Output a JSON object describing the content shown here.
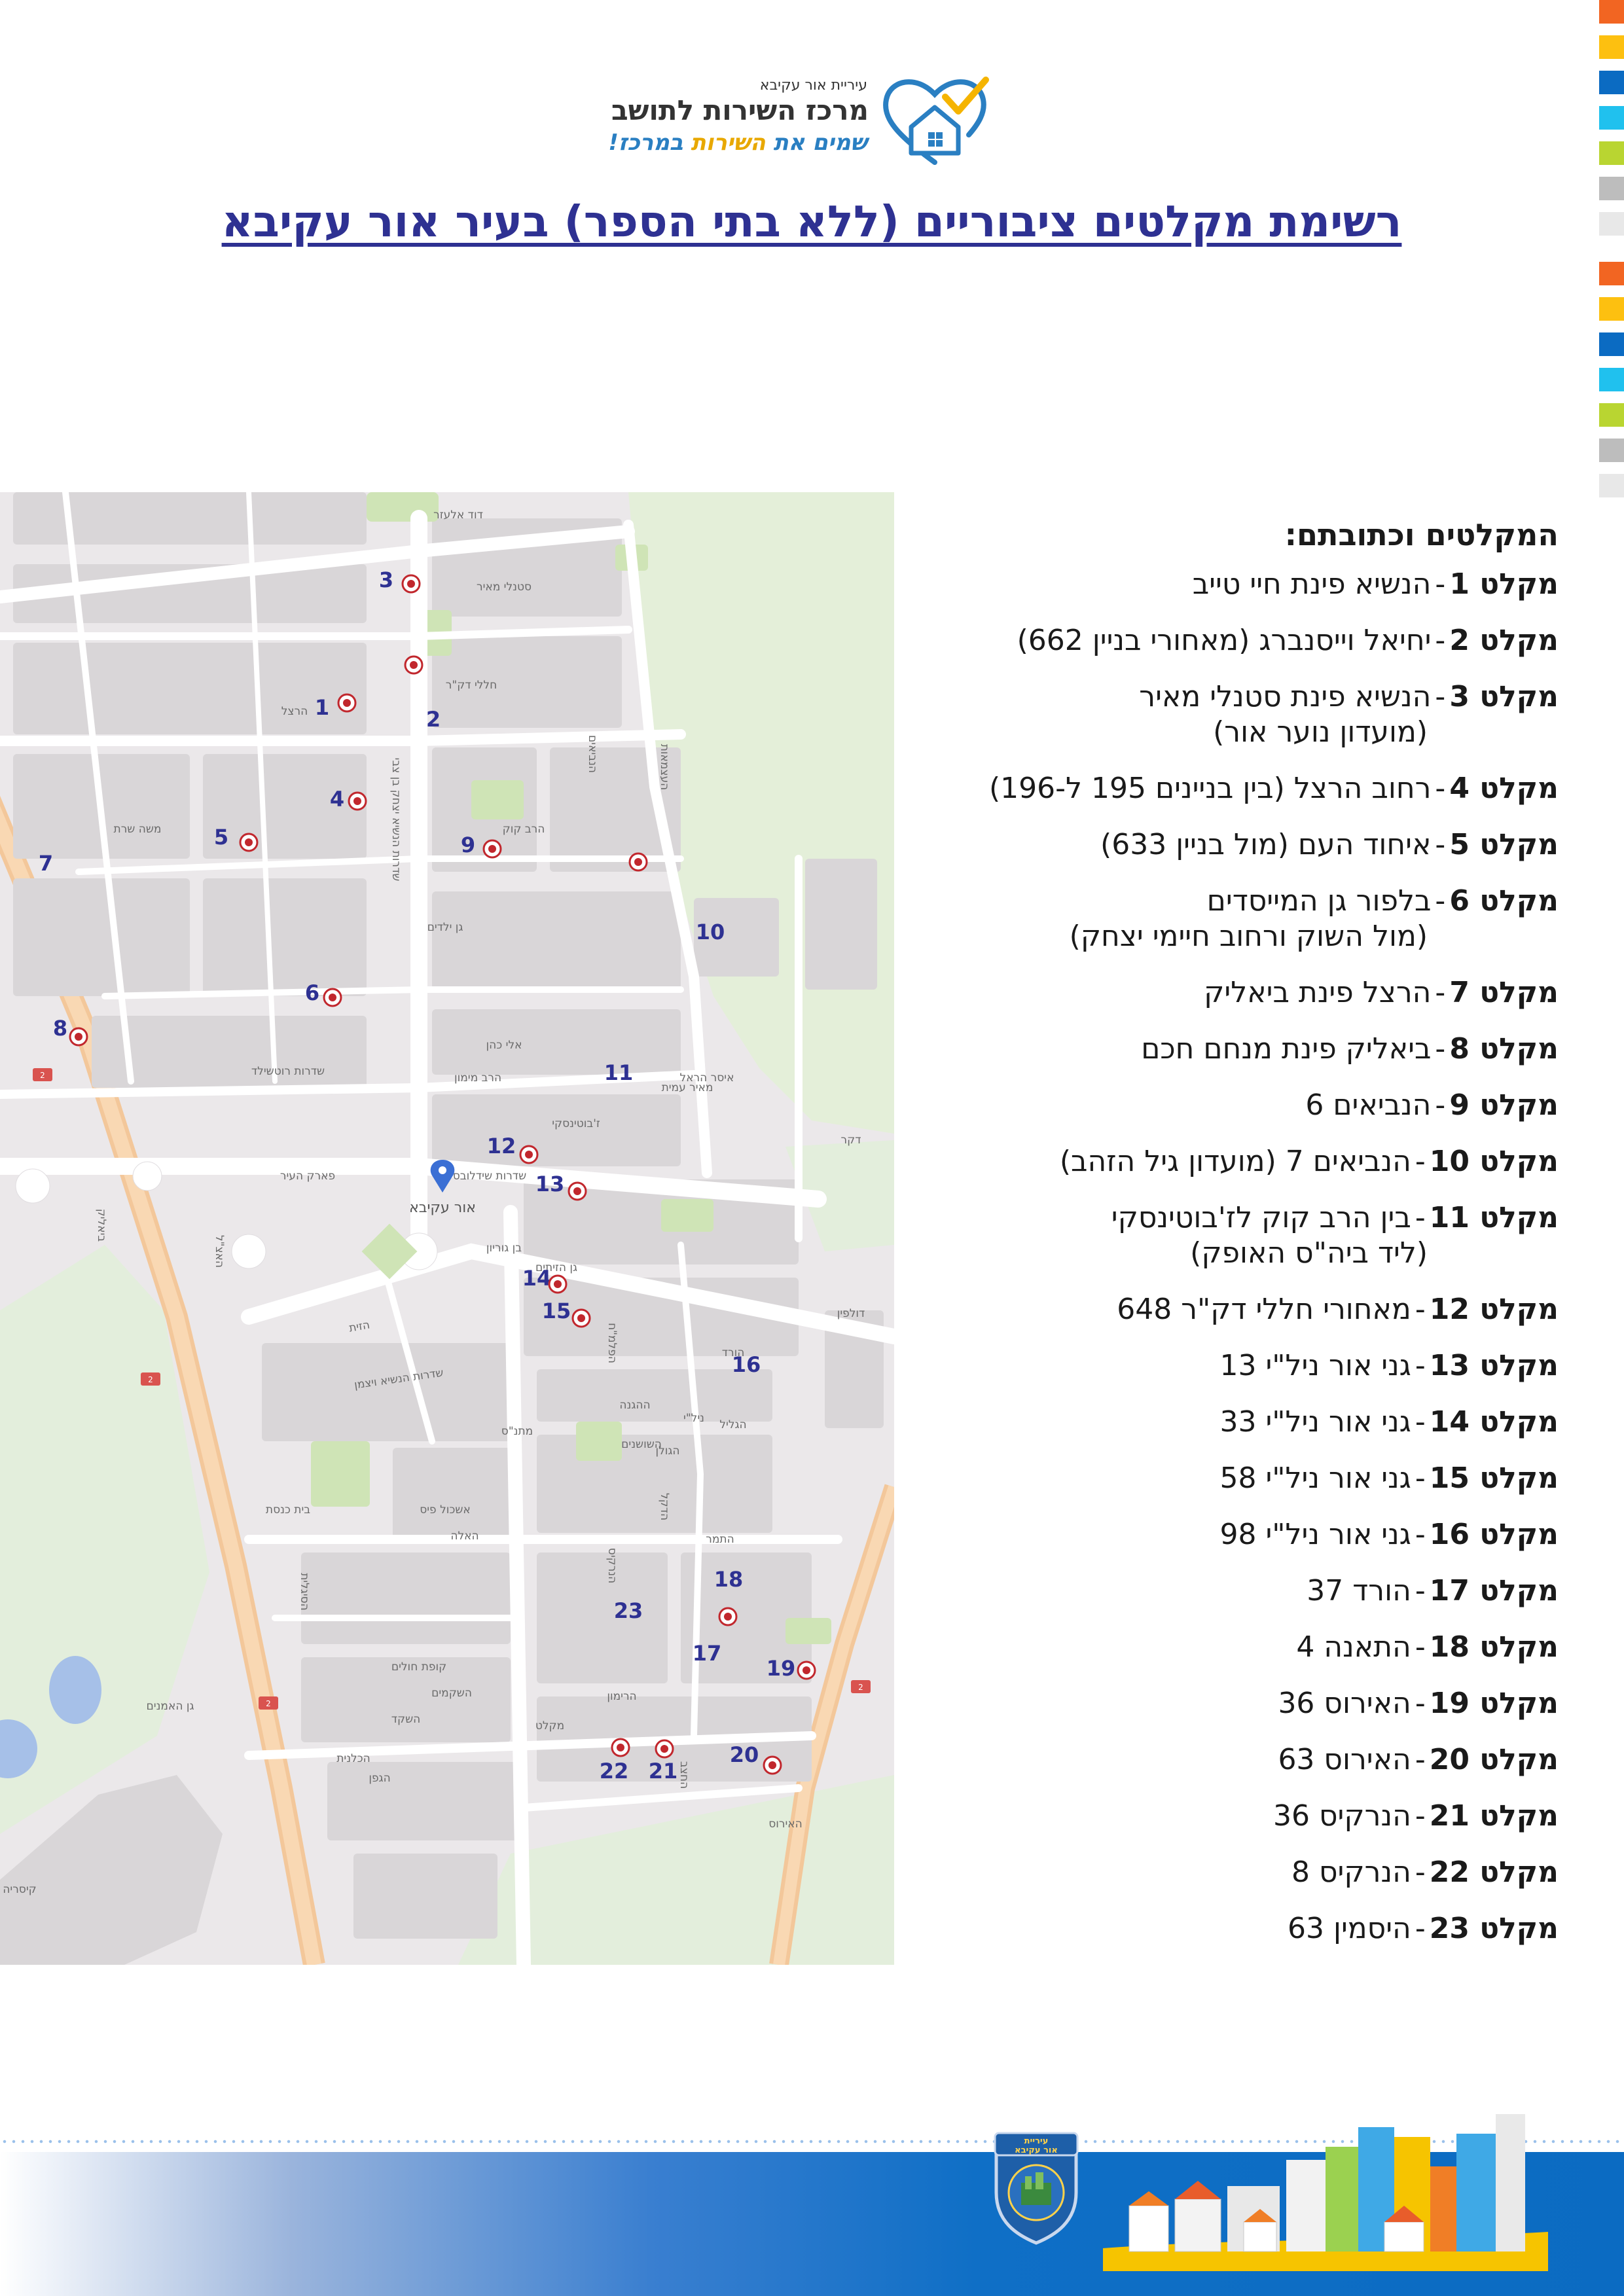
{
  "color_strip": [
    "#f26522",
    "#fdc010",
    "#0b6bc2",
    "#20c1ee",
    "#b9d531",
    "#bdbdbd",
    "#e8e8e8",
    "#f26522",
    "#fdc010",
    "#0b6bc2",
    "#20c1ee",
    "#b9d531",
    "#bdbdbd",
    "#e8e8e8"
  ],
  "logo": {
    "city": "עיריית אור עקיבא",
    "center_name": "מרכז השירות לתושב",
    "slogan_a": "שמים את ",
    "slogan_b": "השירות",
    "slogan_c": " במרכז!"
  },
  "title": "רשימת מקלטים ציבוריים (ללא בתי הספר) בעיר אור עקיבא",
  "list_heading": "המקלטים וכתובתם:",
  "shelters": [
    {
      "label": "מקלט 1",
      "address": "הנשיא פינת חיי טייב"
    },
    {
      "label": "מקלט 2",
      "address": "יחיאל וייסנברג (מאחורי בניין 662)"
    },
    {
      "label": "מקלט 3",
      "address": "הנשיא פינת סטנלי מאיר",
      "note": "(מועדון נוער אור)"
    },
    {
      "label": "מקלט 4",
      "address": "רחוב הרצל (בין בניינים 195 ל-196)"
    },
    {
      "label": "מקלט 5",
      "address": "איחוד העם (מול בניין 633)"
    },
    {
      "label": "מקלט 6",
      "address": "בלפור גן המייסדים",
      "note": "(מול השוק ורחוב חיימי יצחק)"
    },
    {
      "label": "מקלט 7",
      "address": "הרצל פינת ביאליק"
    },
    {
      "label": "מקלט 8",
      "address": "ביאליק פינת מנחם חכם"
    },
    {
      "label": "מקלט 9",
      "address": "הנביאים 6"
    },
    {
      "label": "מקלט 10",
      "address": "הנביאים 7 (מועדון גיל הזהב)"
    },
    {
      "label": "מקלט 11",
      "address": "בין הרב קוק לז'בוטינסקי",
      "note": "(ליד ביה\"ס האופק)"
    },
    {
      "label": "מקלט 12",
      "address": "מאחורי חללי דק\"ר 648"
    },
    {
      "label": "מקלט 13",
      "address": "גני אור ניל\"י 13"
    },
    {
      "label": "מקלט 14",
      "address": "גני אור ניל\"י 33"
    },
    {
      "label": "מקלט 15",
      "address": "גני אור ניל\"י 58"
    },
    {
      "label": "מקלט 16",
      "address": "גני אור ניל\"י 98"
    },
    {
      "label": "מקלט 17",
      "address": "הורד 37"
    },
    {
      "label": "מקלט 18",
      "address": "התאנה 4"
    },
    {
      "label": "מקלט 19",
      "address": "האירוס 36"
    },
    {
      "label": "מקלט 20",
      "address": "האירוס 63"
    },
    {
      "label": "מקלט 21",
      "address": "הנרקיס 36"
    },
    {
      "label": "מקלט 22",
      "address": "הנרקיס 8"
    },
    {
      "label": "מקלט 23",
      "address": "היסמין 63"
    }
  ],
  "map": {
    "city_pin_label": "אור עקיבא",
    "numbers": [
      "1",
      "2",
      "3",
      "4",
      "5",
      "6",
      "7",
      "8",
      "9",
      "10",
      "11",
      "12",
      "13",
      "14",
      "15",
      "16",
      "17",
      "18",
      "19",
      "20",
      "21",
      "22",
      "23"
    ],
    "streets": [
      "דוד אלעזר",
      "שדרות הנשיא יצחק בן צבי",
      "הרצל",
      "ביאליק",
      "חללי דק\"ר",
      "הנביאים",
      "העצמאות",
      "הרב קוק",
      "שדרות שידלובסקי",
      "שדרות הנשיא ויצמן",
      "הגפן",
      "האלה",
      "התמר",
      "הדקל",
      "הרימון",
      "הזית",
      "שדרות רוטשילד",
      "ז'בוטינסקי",
      "מאיר עמית",
      "משה שרת",
      "הנרקיס",
      "האירוס",
      "הסיגלית",
      "החצב",
      "הכלנית",
      "השקד",
      "הגליל",
      "הגולן",
      "ההגנה",
      "הפלמ\"ח",
      "ניל\"י",
      "האצ\"ל",
      "השקמים",
      "השושנים",
      "הורד",
      "בית כנסת",
      "גן ילדים",
      "מקלט",
      "קופת חולים",
      "מתנ\"ס",
      "אשכול פיס",
      "קיסריה",
      "גן האמנים",
      "פארק העיר",
      "סטנלי מאיר",
      "אלי כהן",
      "הרב מימון",
      "בן גוריון",
      "איסר הראל",
      "דקר",
      "דולפין",
      "גן הזיתים"
    ]
  },
  "footer": {
    "emblem_city": "עיריית",
    "emblem_name": "אור עקיבא"
  }
}
